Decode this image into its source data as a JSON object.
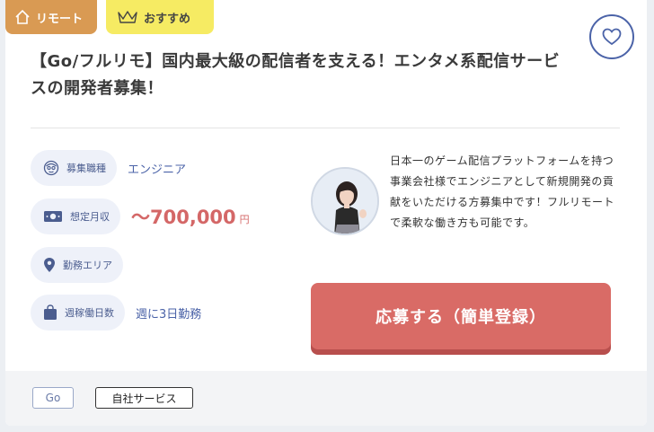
{
  "badges": {
    "remote": "リモート",
    "recommend": "おすすめ"
  },
  "job": {
    "title": "【Go/フルリモ】国内最大級の配信者を支える！エンタメ系配信サービスの開発者募集！"
  },
  "info": [
    {
      "label": "募集職種",
      "value": "エンジニア",
      "icon": "person-icon"
    },
    {
      "label": "想定月収",
      "value": "〜700,000",
      "unit": "円",
      "icon": "money-icon"
    },
    {
      "label": "勤務エリア",
      "value": "",
      "icon": "location-pin-icon"
    },
    {
      "label": "週稼働日数",
      "value": "週に3日勤務",
      "icon": "bag-icon"
    }
  ],
  "description": "日本一のゲーム配信プラットフォームを持つ事業会社様でエンジニアとして新規開発の貢献をいただける方募集中です！フルリモートで柔軟な働き方も可能です。",
  "apply_label": "応募する（簡単登録）",
  "tags": [
    "Go",
    "自社サービス"
  ],
  "colors": {
    "accent": "#4b63a8",
    "apply": "#d96b66",
    "salary": "#d46767",
    "remote_badge": "#d99a53",
    "recommend_badge": "#f6eb63"
  }
}
